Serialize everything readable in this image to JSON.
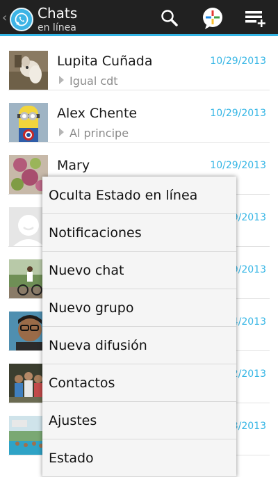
{
  "actionbar": {
    "title": "Chats",
    "subtitle": "en línea",
    "accent_color": "#33b5e5",
    "background_color": "#212121",
    "icons": [
      "back-chevron-icon",
      "whatsapp-logo-icon",
      "search-icon",
      "status-icon",
      "new-chat-icon"
    ]
  },
  "chats": [
    {
      "name": "Lupita Cuñada",
      "date": "10/29/2013",
      "preview": "Igual cdt",
      "avatar": "avatar-dog"
    },
    {
      "name": "Alex Chente",
      "date": "10/29/2013",
      "preview": "Al principe",
      "avatar": "avatar-minion"
    },
    {
      "name": "Mary",
      "date": "10/29/2013",
      "preview": "",
      "avatar": "avatar-flowers"
    },
    {
      "name": "",
      "date": "9/2013",
      "preview": "",
      "avatar": "avatar-placeholder"
    },
    {
      "name": "",
      "date": "9/2013",
      "preview": "",
      "avatar": "avatar-cyclist"
    },
    {
      "name": "",
      "date": "4/2013",
      "preview": "",
      "avatar": "avatar-selfie"
    },
    {
      "name": "",
      "date": "2/2013",
      "preview": "",
      "avatar": "avatar-group"
    },
    {
      "name": "",
      "date": "3/2013",
      "preview": "",
      "avatar": "avatar-pool"
    }
  ],
  "menu": {
    "items": [
      "Oculta Estado en línea",
      "Notificaciones",
      "Nuevo chat",
      "Nuevo grupo",
      "Nueva difusión",
      "Contactos",
      "Ajustes",
      "Estado"
    ]
  }
}
